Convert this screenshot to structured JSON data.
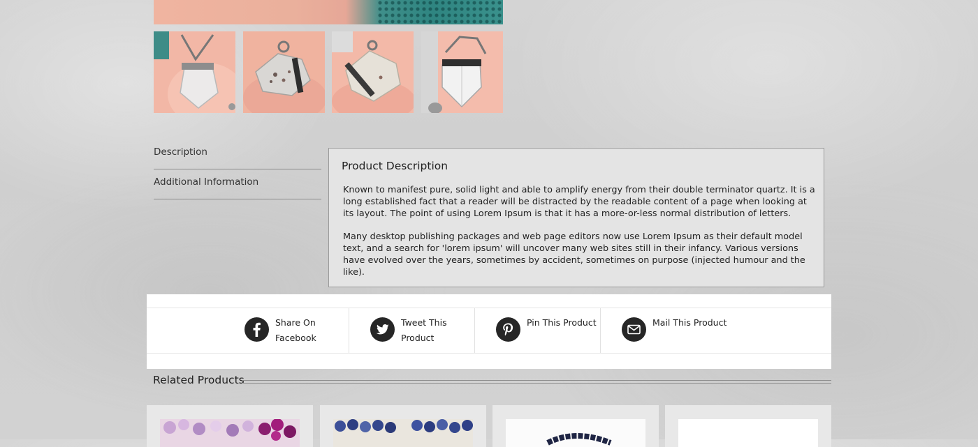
{
  "gallery": {
    "thumbnails": [
      "thumbnail-1",
      "thumbnail-2",
      "thumbnail-3",
      "thumbnail-4"
    ]
  },
  "tabs": [
    {
      "label": "Description"
    },
    {
      "label": "Additional Information"
    }
  ],
  "description": {
    "title": "Product Description",
    "paragraphs": [
      "Known to manifest pure, solid light and able to amplify energy from their double terminator quartz. It is a long established fact that a reader will be distracted by the readable content of a page when looking at its layout. The point of using Lorem Ipsum is that it has a more-or-less normal distribution of letters.",
      "Many desktop publishing packages and web page editors now use Lorem Ipsum as their default model text, and a search for 'lorem ipsum' will uncover many web sites still in their infancy. Various versions have evolved over the years, sometimes by accident, sometimes on purpose (injected humour and the like)."
    ]
  },
  "share": [
    {
      "label": "Share On Facebook",
      "icon": "facebook-icon"
    },
    {
      "label": "Tweet This Product",
      "icon": "twitter-icon"
    },
    {
      "label": "Pin This Product",
      "icon": "pinterest-icon"
    },
    {
      "label": "Mail This Product",
      "icon": "mail-icon"
    }
  ],
  "related": {
    "title": "Related Products",
    "products": [
      "product-1",
      "product-2",
      "product-3",
      "product-4"
    ]
  },
  "colors": {
    "background": "#d2d2d2",
    "panel": "#e4e4e4",
    "icon_circle": "#262626",
    "text": "#222222"
  }
}
